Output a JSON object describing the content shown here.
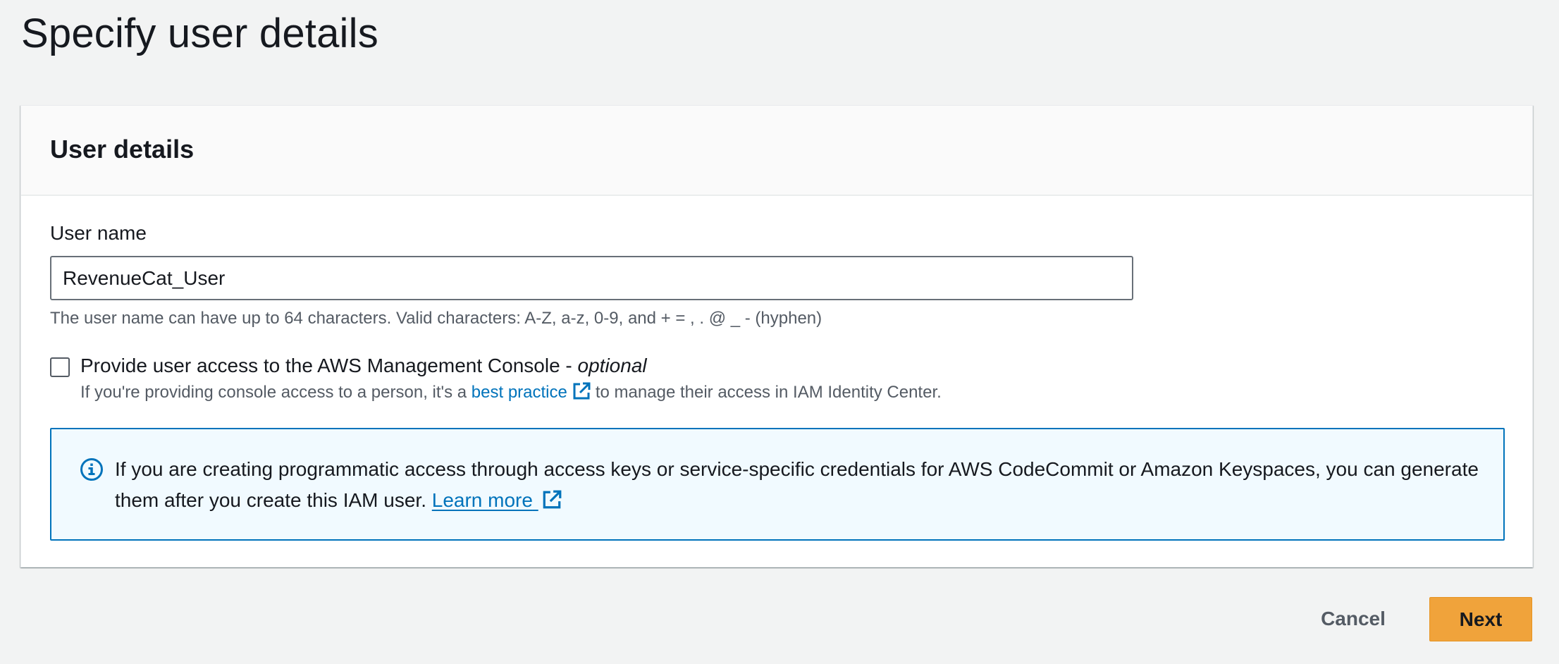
{
  "page": {
    "title": "Specify user details"
  },
  "panel": {
    "heading": "User details",
    "username": {
      "label": "User name",
      "value": "RevenueCat_User",
      "hint": "The user name can have up to 64 characters. Valid characters: A-Z, a-z, 0-9, and + = , . @ _ - (hyphen)"
    },
    "console_access": {
      "label": "Provide user access to the AWS Management Console - ",
      "label_optional": "optional",
      "checked": false,
      "description_prefix": "If you're providing console access to a person, it's a",
      "description_link": "best practice",
      "description_suffix": "to manage their access in IAM Identity Center."
    },
    "info_alert": {
      "icon": "info-icon",
      "text": "If you are creating programmatic access through access keys or service-specific credentials for AWS CodeCommit or Amazon Keyspaces, you can generate them after you create this IAM user.",
      "link": "Learn more"
    }
  },
  "footer": {
    "cancel_label": "Cancel",
    "next_label": "Next"
  },
  "colors": {
    "background": "#f2f3f3",
    "link": "#0073bb",
    "primary_button": "#f0a33b",
    "alert_background": "#f1faff",
    "alert_border": "#0073bb"
  }
}
